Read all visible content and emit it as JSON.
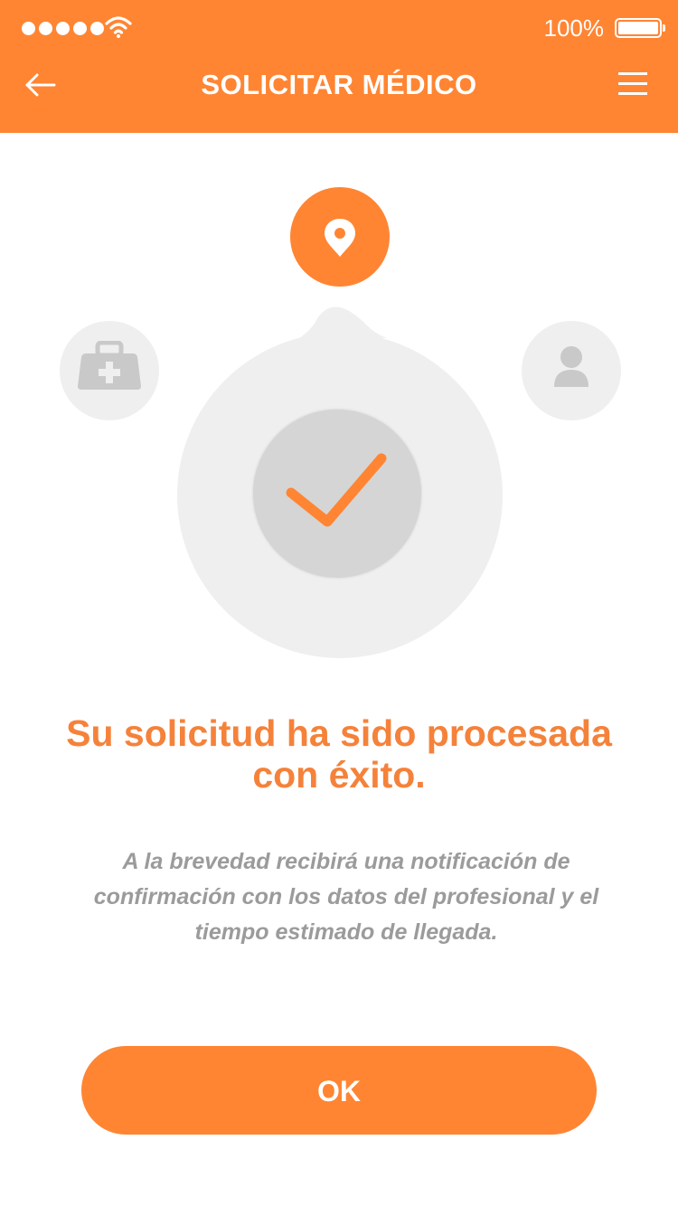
{
  "status_bar": {
    "signal_dots": 5,
    "wifi_icon": "wifi-icon",
    "battery_percent": "100%",
    "battery_level": 1.0
  },
  "header": {
    "title": "SOLICITAR MÉDICO",
    "back_icon": "arrow-left-icon",
    "menu_icon": "hamburger-menu-icon"
  },
  "illustration": {
    "steps": [
      {
        "icon": "medical-kit-icon",
        "state": "inactive"
      },
      {
        "icon": "location-pin-icon",
        "state": "active"
      },
      {
        "icon": "user-icon",
        "state": "inactive"
      }
    ],
    "center_icon": "checkmark-icon"
  },
  "message": {
    "title": "Su solicitud ha sido procesada con éxito.",
    "description": "A la brevedad recibirá una notificación de confirmación con los datos del profesional y el tiempo estimado de llegada."
  },
  "actions": {
    "ok_label": "OK"
  },
  "colors": {
    "accent": "#ff8533",
    "title_text": "#f5823a",
    "muted_text": "#9b9b9b",
    "inactive_circle": "#efefef",
    "check_circle": "#d5d5d5"
  }
}
